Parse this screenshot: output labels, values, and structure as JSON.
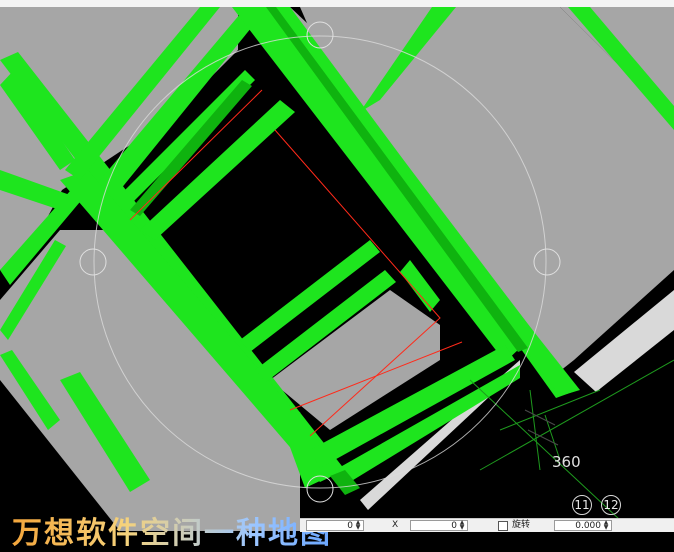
{
  "viewport": {
    "background": "#000000",
    "beam_color": "#1ee51e",
    "slab_color": "#a6a6a6",
    "redline_color": "#ff2a1a",
    "grid_color": "#1e9a1e"
  },
  "dimension_label": "360",
  "axis_markers": [
    "11",
    "12"
  ],
  "caption": "万想软件空间一种地图",
  "statusbar": {
    "x_value": "0",
    "x_label": "X",
    "y_value": "0",
    "rotate_label": "旋转",
    "rotate_value": "0.000"
  }
}
